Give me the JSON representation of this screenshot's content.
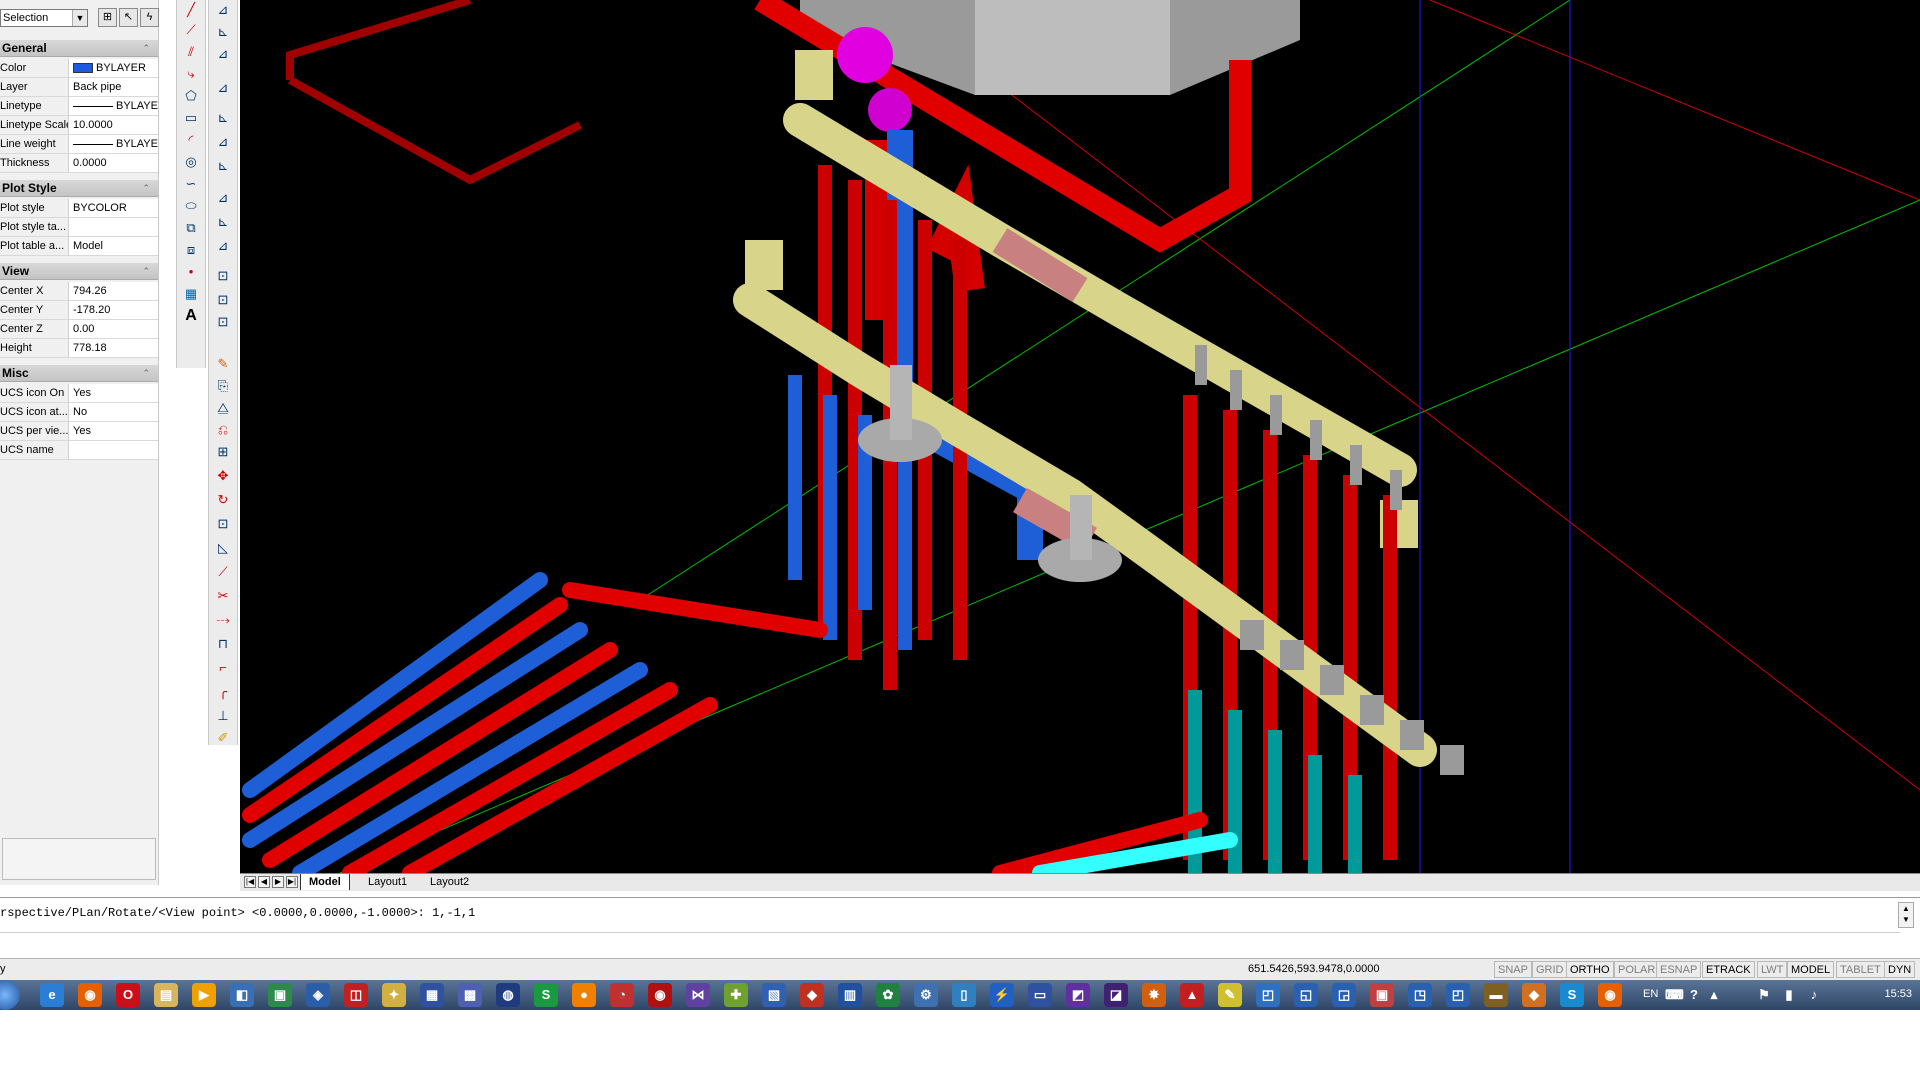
{
  "properties": {
    "selection_label": "Selection",
    "sections": {
      "general": {
        "title": "General",
        "rows": [
          {
            "key": "Color",
            "value": "BYLAYER"
          },
          {
            "key": "Layer",
            "value": "Back pipe"
          },
          {
            "key": "Linetype",
            "value": "BYLAYER"
          },
          {
            "key": "Linetype Scale",
            "value": "10.0000"
          },
          {
            "key": "Line weight",
            "value": "BYLAYER"
          },
          {
            "key": "Thickness",
            "value": "0.0000"
          }
        ]
      },
      "plot_style": {
        "title": "Plot Style",
        "rows": [
          {
            "key": "Plot style",
            "value": "BYCOLOR"
          },
          {
            "key": "Plot style ta...",
            "value": ""
          },
          {
            "key": "Plot table a...",
            "value": "Model"
          }
        ]
      },
      "view": {
        "title": "View",
        "rows": [
          {
            "key": "Center X",
            "value": "794.26"
          },
          {
            "key": "Center Y",
            "value": "-178.20"
          },
          {
            "key": "Center Z",
            "value": "0.00"
          },
          {
            "key": "Height",
            "value": "778.18"
          }
        ]
      },
      "misc": {
        "title": "Misc",
        "rows": [
          {
            "key": "UCS icon On",
            "value": "Yes"
          },
          {
            "key": "UCS icon at...",
            "value": "No"
          },
          {
            "key": "UCS per vie...",
            "value": "Yes"
          },
          {
            "key": "UCS name",
            "value": ""
          }
        ]
      }
    }
  },
  "tabs": [
    "Model",
    "Layout1",
    "Layout2"
  ],
  "command_line": {
    "text": "rspective/PLan/Rotate/<View point> <0.0000,0.0000,-1.0000>: 1,-1,1"
  },
  "status": {
    "left_text": "y",
    "coordinates": "651.5426,593.9478,0.0000",
    "buttons": [
      {
        "label": "SNAP",
        "on": false
      },
      {
        "label": "GRID",
        "on": false
      },
      {
        "label": "ORTHO",
        "on": true
      },
      {
        "label": "POLAR",
        "on": false
      },
      {
        "label": "ESNAP",
        "on": false
      },
      {
        "label": "ETRACK",
        "on": true
      },
      {
        "label": "LWT",
        "on": false
      },
      {
        "label": "MODEL",
        "on": true
      },
      {
        "label": "TABLET",
        "on": false
      },
      {
        "label": "DYN",
        "on": true
      }
    ]
  },
  "taskbar": {
    "language": "EN",
    "time": "15:53"
  },
  "colors": {
    "pipe_red": "#e00000",
    "pipe_blue": "#1e5fd8",
    "manifold": "#d8d48a",
    "valve_gray": "#a9a9a9",
    "fitting_magenta": "#e000e0",
    "pipe_teal": "#009a9a"
  }
}
